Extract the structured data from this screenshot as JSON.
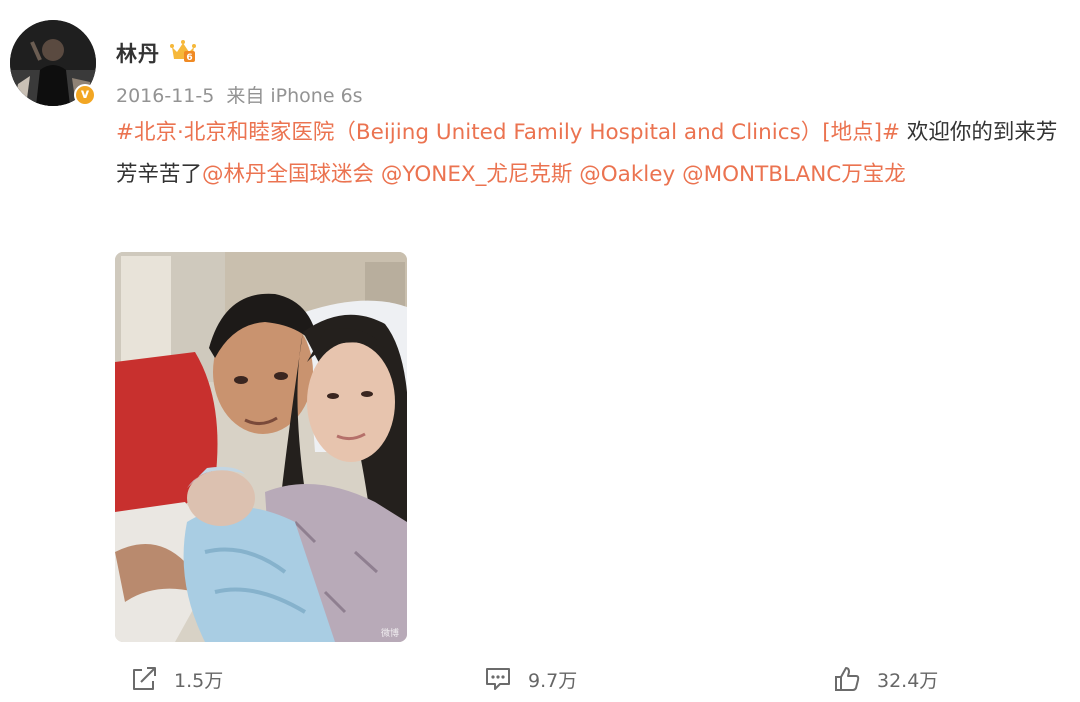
{
  "user": {
    "name": "林丹",
    "vip_level": "6",
    "verified": true,
    "avatar_icon": "user-avatar"
  },
  "post": {
    "date": "2016-11-05",
    "date_display": "2016-11-5",
    "source_prefix": "来自",
    "source_device": "iPhone 6s",
    "text": {
      "topic": "#北京·北京和睦家医院（Beijing United Family Hospital and Clinics）[地点]#",
      "body": " 欢迎你的到来芳芳辛苦了",
      "mentions": [
        "@林丹全国球迷会",
        "@YONEX_尤尼克斯",
        "@Oakley",
        "@MONTBLANC万宝龙"
      ]
    },
    "image": {
      "watermark": "微博"
    }
  },
  "actions": {
    "share_count": "1.5万",
    "comment_count": "9.7万",
    "like_count": "32.4万"
  },
  "colors": {
    "link": "#eb7350",
    "meta": "#939393",
    "text": "#333333",
    "badge": "#f2a623"
  }
}
